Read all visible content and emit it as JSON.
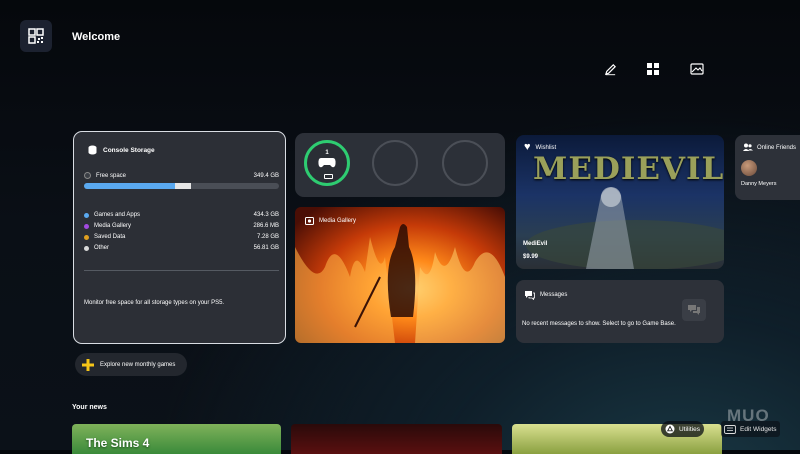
{
  "header": {
    "title": "Welcome"
  },
  "toolbar": {
    "edit_icon": "pencil-icon",
    "grid_icon": "grid-icon",
    "wallpaper_icon": "image-icon"
  },
  "storage": {
    "title": "Console Storage",
    "free_label": "Free space",
    "free_value": "349.4 GB",
    "free_fraction": 0.55,
    "items": [
      {
        "label": "Games and Apps",
        "value": "434.3 GB",
        "color": "#5aa9f0"
      },
      {
        "label": "Media Gallery",
        "value": "286.6 MB",
        "color": "#a24ae0"
      },
      {
        "label": "Saved Data",
        "value": "7.28 GB",
        "color": "#e0a020"
      },
      {
        "label": "Other",
        "value": "56.81 GB",
        "color": "#d9d9d9"
      }
    ],
    "footer": "Monitor free space for all storage types on your PS5."
  },
  "controllers": {
    "count": "1",
    "accent": "#2ecc71"
  },
  "media_gallery": {
    "title": "Media Gallery"
  },
  "wishlist": {
    "title": "Wishlist",
    "game_logo": "MEDIEVIL",
    "game_name": "MediEvil",
    "price": "$9.99"
  },
  "messages": {
    "title": "Messages",
    "body": "No recent messages to show. Select to go to Game Base."
  },
  "friends": {
    "title": "Online Friends",
    "name": "Danny Meyers"
  },
  "explore": {
    "label": "Explore new monthly games"
  },
  "news": {
    "title": "Your news",
    "thumb_text": "The Sims 4"
  },
  "hints": {
    "utilities": "Utilities",
    "edit_widgets": "Edit Widgets"
  },
  "watermark": "MUO"
}
